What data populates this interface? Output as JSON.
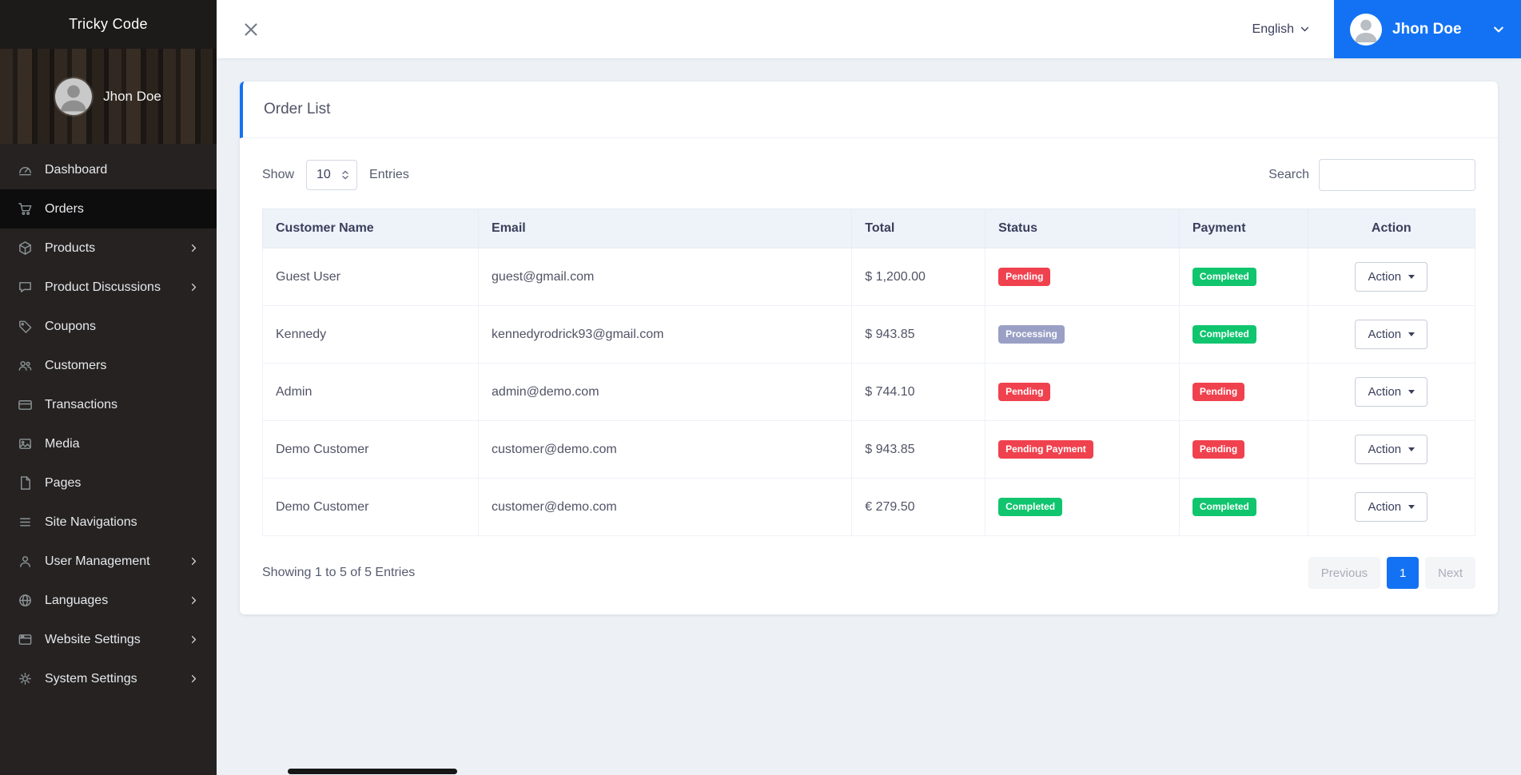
{
  "colors": {
    "primary": "#1372f3",
    "danger": "#f0414e",
    "success": "#10c56e",
    "muted_badge": "#9aa0c5"
  },
  "brand": {
    "title": "Tricky Code"
  },
  "sidebar": {
    "profile_name": "Jhon Doe",
    "items": [
      {
        "label": "Dashboard",
        "icon": "dashboard-icon",
        "active": false,
        "has_submenu": false
      },
      {
        "label": "Orders",
        "icon": "orders-icon",
        "active": true,
        "has_submenu": false
      },
      {
        "label": "Products",
        "icon": "products-icon",
        "active": false,
        "has_submenu": true
      },
      {
        "label": "Product Discussions",
        "icon": "discussions-icon",
        "active": false,
        "has_submenu": true
      },
      {
        "label": "Coupons",
        "icon": "coupons-icon",
        "active": false,
        "has_submenu": false
      },
      {
        "label": "Customers",
        "icon": "customers-icon",
        "active": false,
        "has_submenu": false
      },
      {
        "label": "Transactions",
        "icon": "transactions-icon",
        "active": false,
        "has_submenu": false
      },
      {
        "label": "Media",
        "icon": "media-icon",
        "active": false,
        "has_submenu": false
      },
      {
        "label": "Pages",
        "icon": "pages-icon",
        "active": false,
        "has_submenu": false
      },
      {
        "label": "Site Navigations",
        "icon": "site-navigations-icon",
        "active": false,
        "has_submenu": false
      },
      {
        "label": "User Management",
        "icon": "user-management-icon",
        "active": false,
        "has_submenu": true
      },
      {
        "label": "Languages",
        "icon": "languages-icon",
        "active": false,
        "has_submenu": true
      },
      {
        "label": "Website Settings",
        "icon": "website-settings-icon",
        "active": false,
        "has_submenu": true
      },
      {
        "label": "System Settings",
        "icon": "system-settings-icon",
        "active": false,
        "has_submenu": true
      }
    ]
  },
  "topbar": {
    "language": "English",
    "user_name": "Jhon Doe"
  },
  "page_title": "Order List",
  "controls": {
    "show_label": "Show",
    "page_size": "10",
    "entries_label": "Entries",
    "search_label": "Search",
    "search_value": ""
  },
  "table": {
    "headers": [
      "Customer Name",
      "Email",
      "Total",
      "Status",
      "Payment",
      "Action"
    ],
    "rows": [
      {
        "customer": "Guest User",
        "email": "guest@gmail.com",
        "total": "$ 1,200.00",
        "status": {
          "label": "Pending",
          "variant": "danger"
        },
        "payment": {
          "label": "Completed",
          "variant": "success"
        },
        "action_label": "Action"
      },
      {
        "customer": "Kennedy",
        "email": "kennedyrodrick93@gmail.com",
        "total": "$ 943.85",
        "status": {
          "label": "Processing",
          "variant": "muted"
        },
        "payment": {
          "label": "Completed",
          "variant": "success"
        },
        "action_label": "Action"
      },
      {
        "customer": "Admin",
        "email": "admin@demo.com",
        "total": "$ 744.10",
        "status": {
          "label": "Pending",
          "variant": "danger"
        },
        "payment": {
          "label": "Pending",
          "variant": "danger"
        },
        "action_label": "Action"
      },
      {
        "customer": "Demo Customer",
        "email": "customer@demo.com",
        "total": "$ 943.85",
        "status": {
          "label": "Pending Payment",
          "variant": "danger"
        },
        "payment": {
          "label": "Pending",
          "variant": "danger"
        },
        "action_label": "Action"
      },
      {
        "customer": "Demo Customer",
        "email": "customer@demo.com",
        "total": "€ 279.50",
        "status": {
          "label": "Completed",
          "variant": "success"
        },
        "payment": {
          "label": "Completed",
          "variant": "success"
        },
        "action_label": "Action"
      }
    ]
  },
  "footer": {
    "summary": "Showing 1 to 5 of 5 Entries",
    "pagination": {
      "previous": "Previous",
      "current_page": "1",
      "next": "Next"
    }
  }
}
